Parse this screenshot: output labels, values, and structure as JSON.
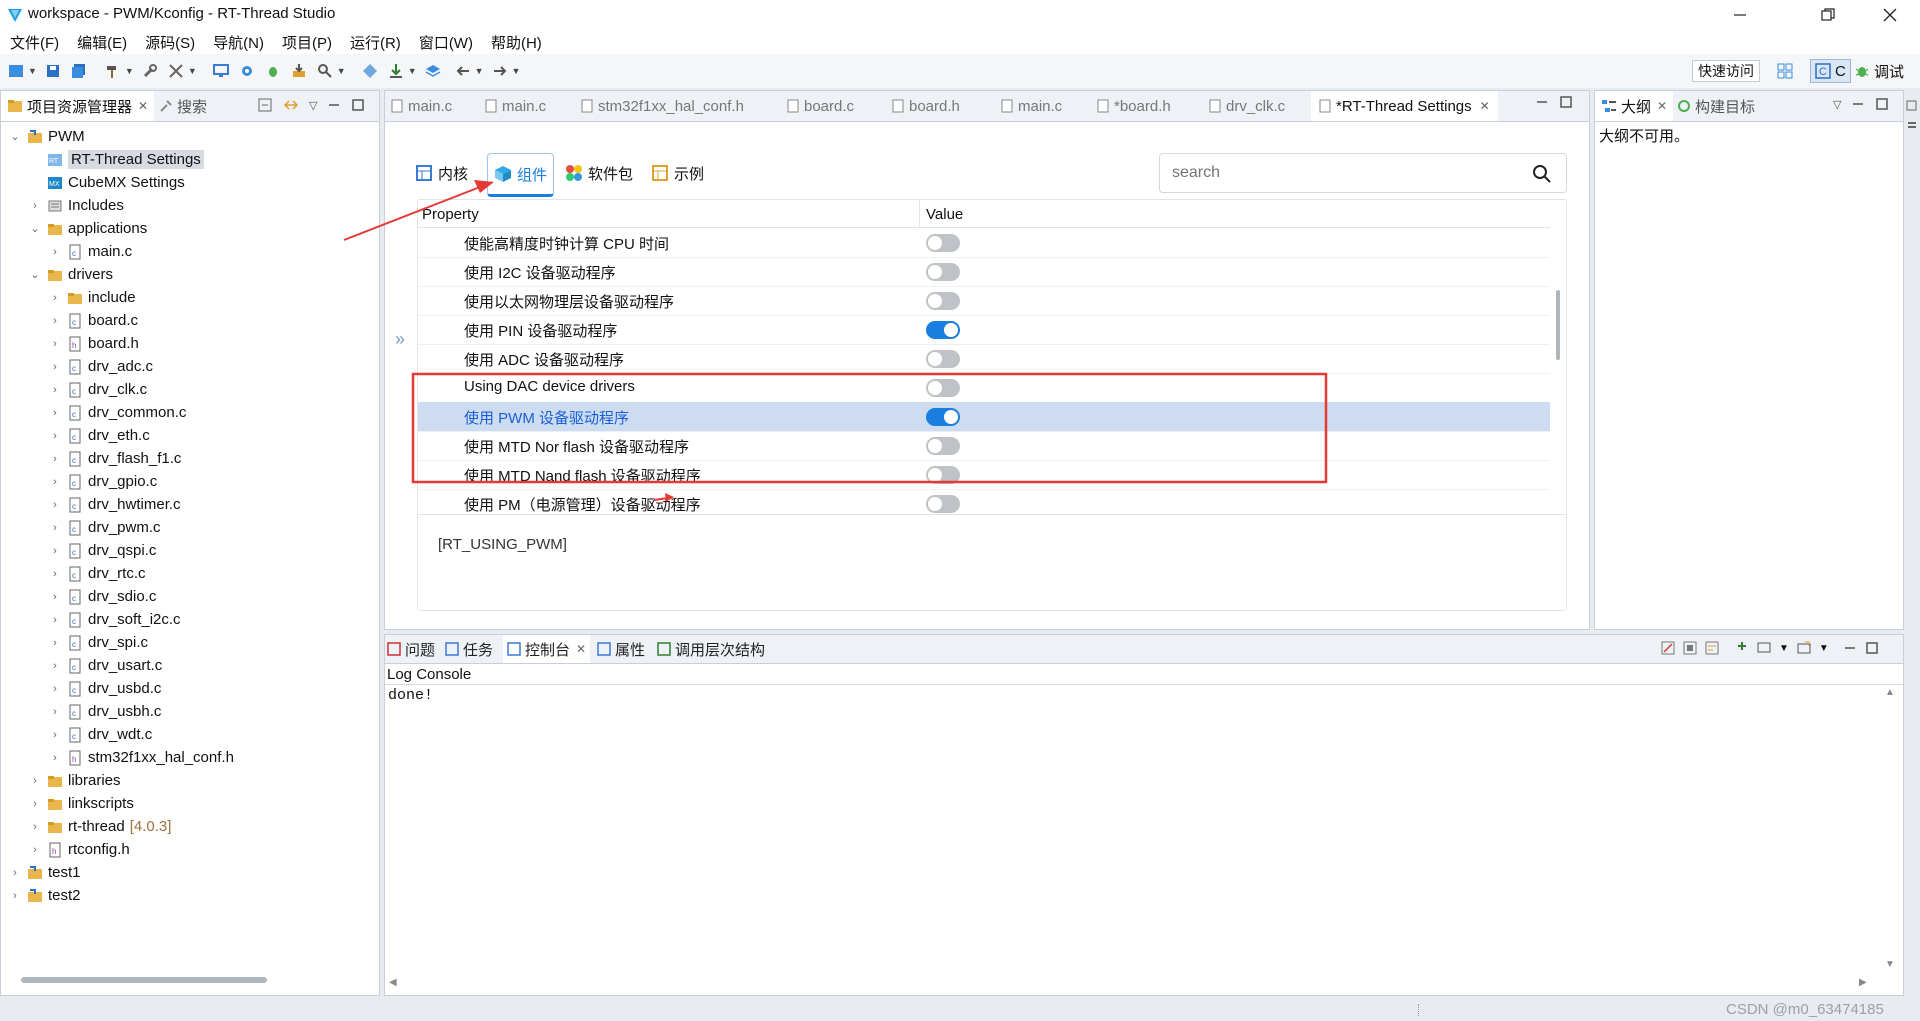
{
  "window": {
    "title": "workspace - PWM/Kconfig - RT-Thread Studio"
  },
  "menu": [
    "文件(F)",
    "编辑(E)",
    "源码(S)",
    "导航(N)",
    "项目(P)",
    "运行(R)",
    "窗口(W)",
    "帮助(H)"
  ],
  "toolbar": {
    "quick_access": "快速访问",
    "debug_label": "调试",
    "c_label": "C"
  },
  "project_explorer": {
    "tab_label": "项目资源管理器",
    "search_tab": "搜索",
    "tree": [
      {
        "label": "PWM",
        "depth": 0,
        "icon": "project-icon",
        "twisty": "v"
      },
      {
        "label": "RT-Thread Settings",
        "depth": 1,
        "icon": "rt-settings-icon",
        "twisty": "",
        "selected": true
      },
      {
        "label": "CubeMX Settings",
        "depth": 1,
        "icon": "cubemx-icon",
        "twisty": ""
      },
      {
        "label": "Includes",
        "depth": 1,
        "icon": "includes-icon",
        "twisty": ">"
      },
      {
        "label": "applications",
        "depth": 1,
        "icon": "folder-icon",
        "twisty": "v"
      },
      {
        "label": "main.c",
        "depth": 2,
        "icon": "c-file-icon",
        "twisty": ">"
      },
      {
        "label": "drivers",
        "depth": 1,
        "icon": "folder-icon",
        "twisty": "v"
      },
      {
        "label": "include",
        "depth": 2,
        "icon": "folder-icon",
        "twisty": ">"
      },
      {
        "label": "board.c",
        "depth": 2,
        "icon": "c-file-icon",
        "twisty": ">"
      },
      {
        "label": "board.h",
        "depth": 2,
        "icon": "h-file-icon",
        "twisty": ">"
      },
      {
        "label": "drv_adc.c",
        "depth": 2,
        "icon": "c-file-icon",
        "twisty": ">"
      },
      {
        "label": "drv_clk.c",
        "depth": 2,
        "icon": "c-file-icon",
        "twisty": ">"
      },
      {
        "label": "drv_common.c",
        "depth": 2,
        "icon": "c-file-icon",
        "twisty": ">"
      },
      {
        "label": "drv_eth.c",
        "depth": 2,
        "icon": "c-file-icon",
        "twisty": ">"
      },
      {
        "label": "drv_flash_f1.c",
        "depth": 2,
        "icon": "c-file-icon",
        "twisty": ">"
      },
      {
        "label": "drv_gpio.c",
        "depth": 2,
        "icon": "c-file-icon",
        "twisty": ">"
      },
      {
        "label": "drv_hwtimer.c",
        "depth": 2,
        "icon": "c-file-icon",
        "twisty": ">"
      },
      {
        "label": "drv_pwm.c",
        "depth": 2,
        "icon": "c-file-icon",
        "twisty": ">"
      },
      {
        "label": "drv_qspi.c",
        "depth": 2,
        "icon": "c-file-icon",
        "twisty": ">"
      },
      {
        "label": "drv_rtc.c",
        "depth": 2,
        "icon": "c-file-icon",
        "twisty": ">"
      },
      {
        "label": "drv_sdio.c",
        "depth": 2,
        "icon": "c-file-icon",
        "twisty": ">"
      },
      {
        "label": "drv_soft_i2c.c",
        "depth": 2,
        "icon": "c-file-icon",
        "twisty": ">"
      },
      {
        "label": "drv_spi.c",
        "depth": 2,
        "icon": "c-file-icon",
        "twisty": ">"
      },
      {
        "label": "drv_usart.c",
        "depth": 2,
        "icon": "c-file-icon",
        "twisty": ">"
      },
      {
        "label": "drv_usbd.c",
        "depth": 2,
        "icon": "c-file-icon",
        "twisty": ">"
      },
      {
        "label": "drv_usbh.c",
        "depth": 2,
        "icon": "c-file-icon",
        "twisty": ">"
      },
      {
        "label": "drv_wdt.c",
        "depth": 2,
        "icon": "c-file-icon",
        "twisty": ">"
      },
      {
        "label": "stm32f1xx_hal_conf.h",
        "depth": 2,
        "icon": "h-file-icon",
        "twisty": ">"
      },
      {
        "label": "libraries",
        "depth": 1,
        "icon": "folder-icon",
        "twisty": ">"
      },
      {
        "label": "linkscripts",
        "depth": 1,
        "icon": "folder-icon",
        "twisty": ">"
      },
      {
        "label": "rt-thread",
        "depth": 1,
        "icon": "folder-icon",
        "twisty": ">",
        "suffix": "[4.0.3]"
      },
      {
        "label": "rtconfig.h",
        "depth": 1,
        "icon": "h-file-icon",
        "twisty": ">"
      },
      {
        "label": "test1",
        "depth": 0,
        "icon": "project-icon",
        "twisty": ">"
      },
      {
        "label": "test2",
        "depth": 0,
        "icon": "project-icon",
        "twisty": ">"
      }
    ]
  },
  "editor": {
    "tabs": [
      {
        "label": "main.c"
      },
      {
        "label": "main.c"
      },
      {
        "label": "stm32f1xx_hal_conf.h"
      },
      {
        "label": "board.c"
      },
      {
        "label": "board.h"
      },
      {
        "label": "main.c"
      },
      {
        "label": "*board.h"
      },
      {
        "label": "drv_clk.c"
      },
      {
        "label": "*RT-Thread Settings",
        "active": true
      }
    ],
    "settings_tabs": [
      {
        "label": "内核",
        "icon": "kernel-icon"
      },
      {
        "label": "组件",
        "icon": "component-icon",
        "active": true
      },
      {
        "label": "软件包",
        "icon": "package-icon"
      },
      {
        "label": "示例",
        "icon": "example-icon"
      }
    ],
    "search_placeholder": "search",
    "columns": {
      "property": "Property",
      "value": "Value"
    },
    "rows": [
      {
        "label": "使能高精度时钟计算 CPU 时间",
        "on": false
      },
      {
        "label": "使用 I2C 设备驱动程序",
        "on": false
      },
      {
        "label": "使用以太网物理层设备驱动程序",
        "on": false
      },
      {
        "label": "使用 PIN 设备驱动程序",
        "on": true
      },
      {
        "label": "使用 ADC 设备驱动程序",
        "on": false
      },
      {
        "label": "Using DAC device drivers",
        "on": false
      },
      {
        "label": "使用 PWM 设备驱动程序",
        "on": true,
        "selected": true
      },
      {
        "label": "使用 MTD Nor flash 设备驱动程序",
        "on": false
      },
      {
        "label": "使用 MTD Nand flash 设备驱动程序",
        "on": false
      },
      {
        "label": "使用 PM（电源管理）设备驱动程序",
        "on": false
      }
    ],
    "macro": "[RT_USING_PWM]"
  },
  "outline": {
    "tab_label": "大纲",
    "build_targets_tab": "构建目标",
    "message": "大纲不可用。"
  },
  "bottom": {
    "tabs": [
      {
        "label": "问题"
      },
      {
        "label": "任务"
      },
      {
        "label": "控制台",
        "active": true
      },
      {
        "label": "属性"
      },
      {
        "label": "调用层次结构"
      }
    ],
    "console_title": "Log Console",
    "console_output": "done!"
  },
  "watermark": "CSDN @m0_63474185",
  "colors": {
    "accent": "#1a7de0",
    "annotation_red": "#e53935",
    "selection": "#cddcf0"
  }
}
